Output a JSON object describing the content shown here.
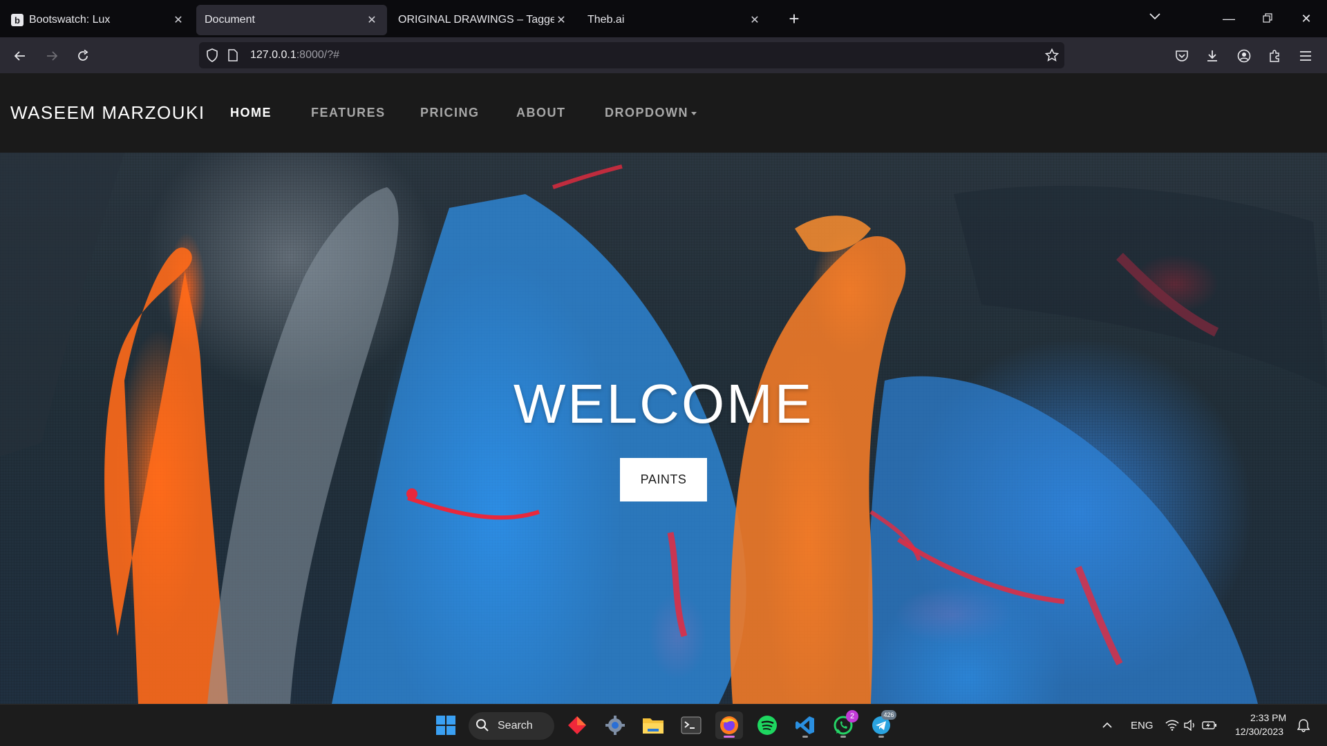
{
  "browser": {
    "tabs": [
      {
        "title": "Bootswatch: Lux",
        "favicon": "b",
        "active": false
      },
      {
        "title": "Document",
        "active": true
      },
      {
        "title": "ORIGINAL DRAWINGS – Tagged \"A",
        "active": false
      },
      {
        "title": "Theb.ai",
        "active": false
      }
    ],
    "url_host": "127.0.0.1",
    "url_path": ":8000/?#"
  },
  "site": {
    "brand": "WASEEM MARZOUKI",
    "nav": [
      {
        "label": "HOME",
        "active": true
      },
      {
        "label": "FEATURES",
        "active": false
      },
      {
        "label": "PRICING",
        "active": false
      },
      {
        "label": "ABOUT",
        "active": false
      },
      {
        "label": "DROPDOWN",
        "active": false
      }
    ],
    "hero": {
      "title": "WELCOME",
      "button_label": "PAINTS"
    }
  },
  "taskbar": {
    "search_label": "Search",
    "whatsapp_badge": "2",
    "telegram_badge": "426",
    "language": "ENG",
    "time": "2:33 PM",
    "date": "12/30/2023"
  },
  "colors": {
    "page_nav_bg": "#1a1a1a",
    "browser_chrome": "#2b2a33",
    "hero_orange": "#ff6e1e",
    "hero_blue": "#288ce6"
  }
}
